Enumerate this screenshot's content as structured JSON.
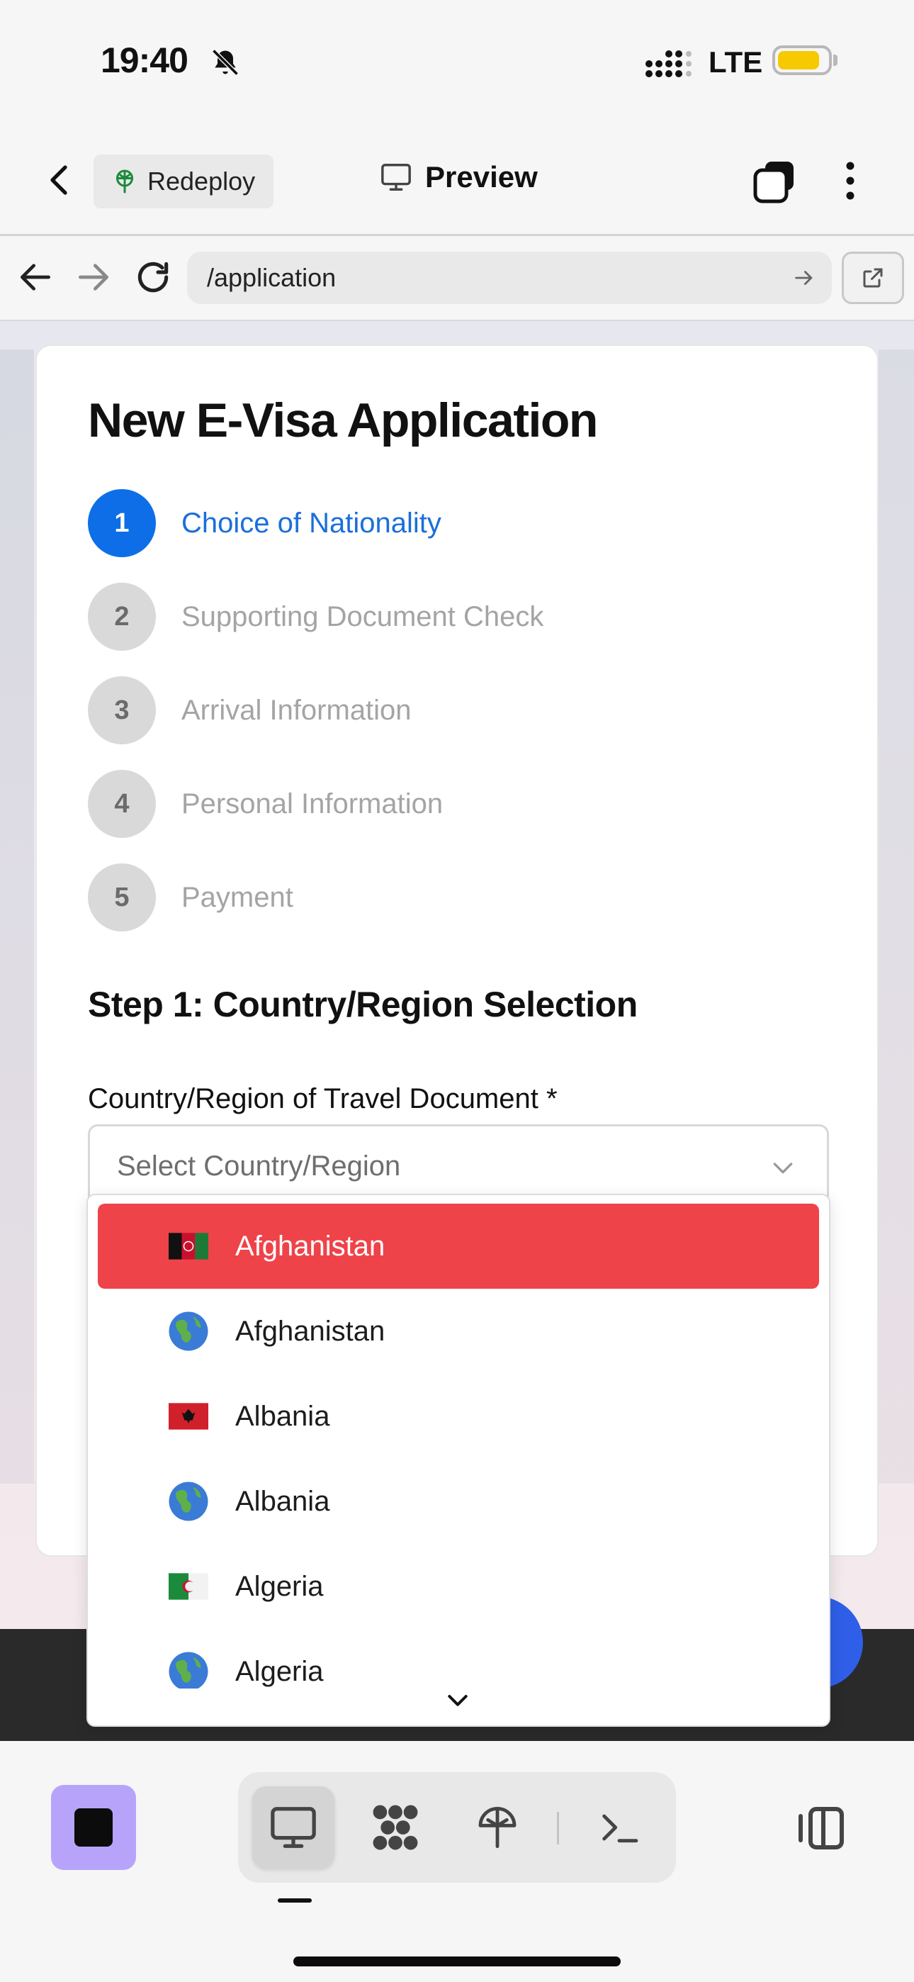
{
  "status_bar": {
    "time": "19:40",
    "network": "LTE"
  },
  "header": {
    "redeploy_label": "Redeploy",
    "preview_label": "Preview"
  },
  "browser": {
    "url": "/application"
  },
  "form": {
    "title": "New E-Visa Application",
    "steps": [
      {
        "num": "1",
        "label": "Choice of Nationality",
        "active": true
      },
      {
        "num": "2",
        "label": "Supporting Document Check",
        "active": false
      },
      {
        "num": "3",
        "label": "Arrival Information",
        "active": false
      },
      {
        "num": "4",
        "label": "Personal Information",
        "active": false
      },
      {
        "num": "5",
        "label": "Payment",
        "active": false
      }
    ],
    "section_title": "Step 1: Country/Region Selection",
    "field_label": "Country/Region of Travel Document *",
    "select_placeholder": "Select Country/Region"
  },
  "dropdown": {
    "options": [
      {
        "label": "Afghanistan",
        "icon": "afghanistan-flag-icon",
        "selected": true
      },
      {
        "label": "Afghanistan",
        "icon": "globe-icon",
        "selected": false
      },
      {
        "label": "Albania",
        "icon": "albania-flag-icon",
        "selected": false
      },
      {
        "label": "Albania",
        "icon": "globe-icon",
        "selected": false
      },
      {
        "label": "Algeria",
        "icon": "algeria-flag-icon",
        "selected": false
      },
      {
        "label": "Algeria",
        "icon": "globe-icon",
        "selected": false
      }
    ]
  },
  "colors": {
    "accent": "#0d6ee8",
    "selected_option": "#ee4349",
    "stop_button": "#b7a4fa",
    "battery": "#f7c900"
  }
}
